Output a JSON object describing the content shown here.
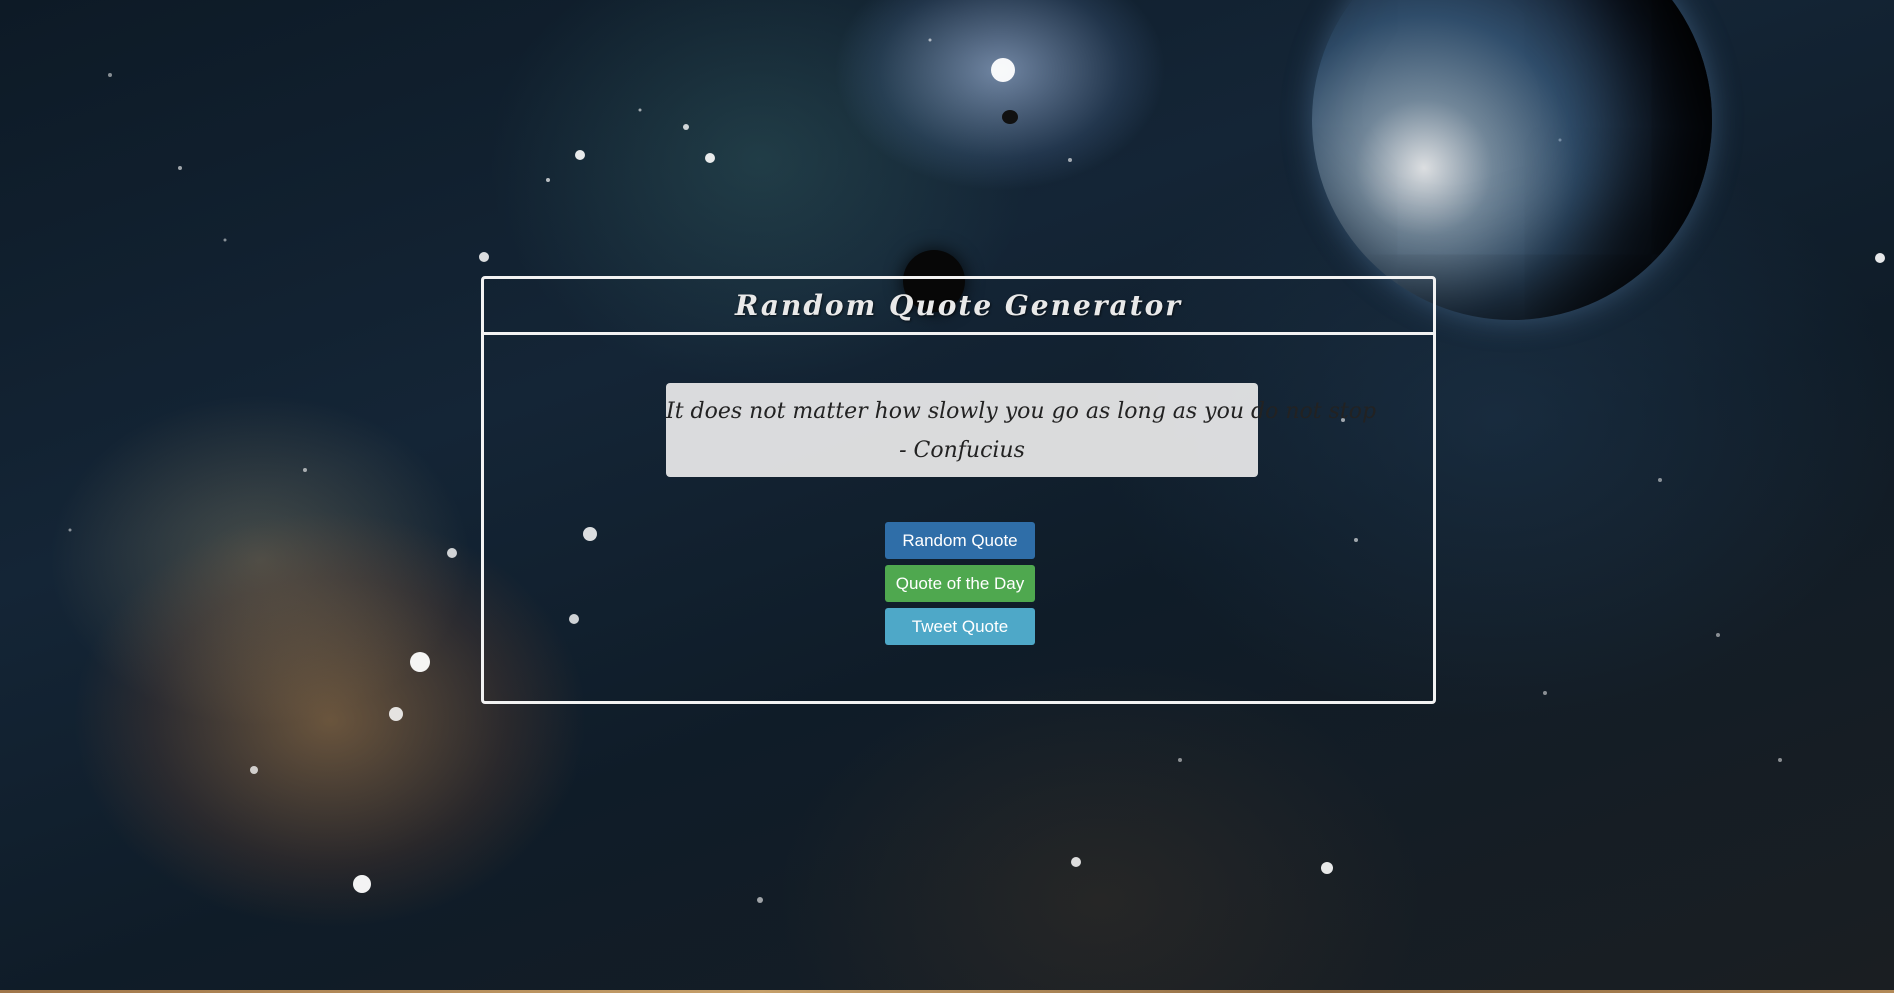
{
  "page": {
    "title": "Random Quote Generator"
  },
  "quote": {
    "text": "It does not matter how slowly you go as long as you do not stop",
    "author": "- Confucius"
  },
  "buttons": {
    "random_label": "Random Quote",
    "day_label": "Quote of the Day",
    "tweet_label": "Tweet Quote"
  },
  "colors": {
    "random": "#2f6ea8",
    "day": "#4fa84f",
    "tweet": "#4ea8c8",
    "panel_border": "#f2f2f2"
  }
}
